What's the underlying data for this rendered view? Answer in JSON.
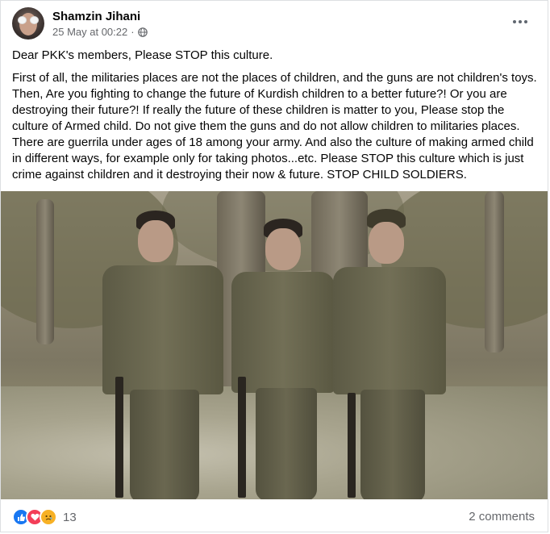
{
  "post": {
    "author": "Shamzin Jihani",
    "timestamp": "25 May at 00:22",
    "audience_icon": "globe-icon",
    "more_icon": "more-options-icon",
    "paragraphs": [
      "Dear PKK's members, Please STOP this culture.",
      "First of all, the militaries places are not the places of children, and the guns are not children's toys. Then, Are you fighting to change the future of Kurdish children to a better future?! Or you are destroying their future?! If really the future of these children is matter to you, Please stop the culture of Armed child. Do not give them the guns and do not allow children to militaries places. There are guerrila under ages of 18 among your army. And also the culture of making armed child in different ways, for example only for taking photos...etc. Please STOP this culture which is just crime against children and it destroying their now & future. STOP CHILD SOLDIERS."
    ],
    "photo_icon": "photo-of-three-children-in-uniform"
  },
  "footer": {
    "reaction_icons": [
      "like-icon",
      "love-icon",
      "sad-icon"
    ],
    "reaction_count": "13",
    "comments_label": "2 comments"
  },
  "colors": {
    "facebook_blue": "#1877f2",
    "love_red": "#f33e58",
    "sad_yellow": "#f7b125",
    "secondary_text": "#65676b"
  }
}
